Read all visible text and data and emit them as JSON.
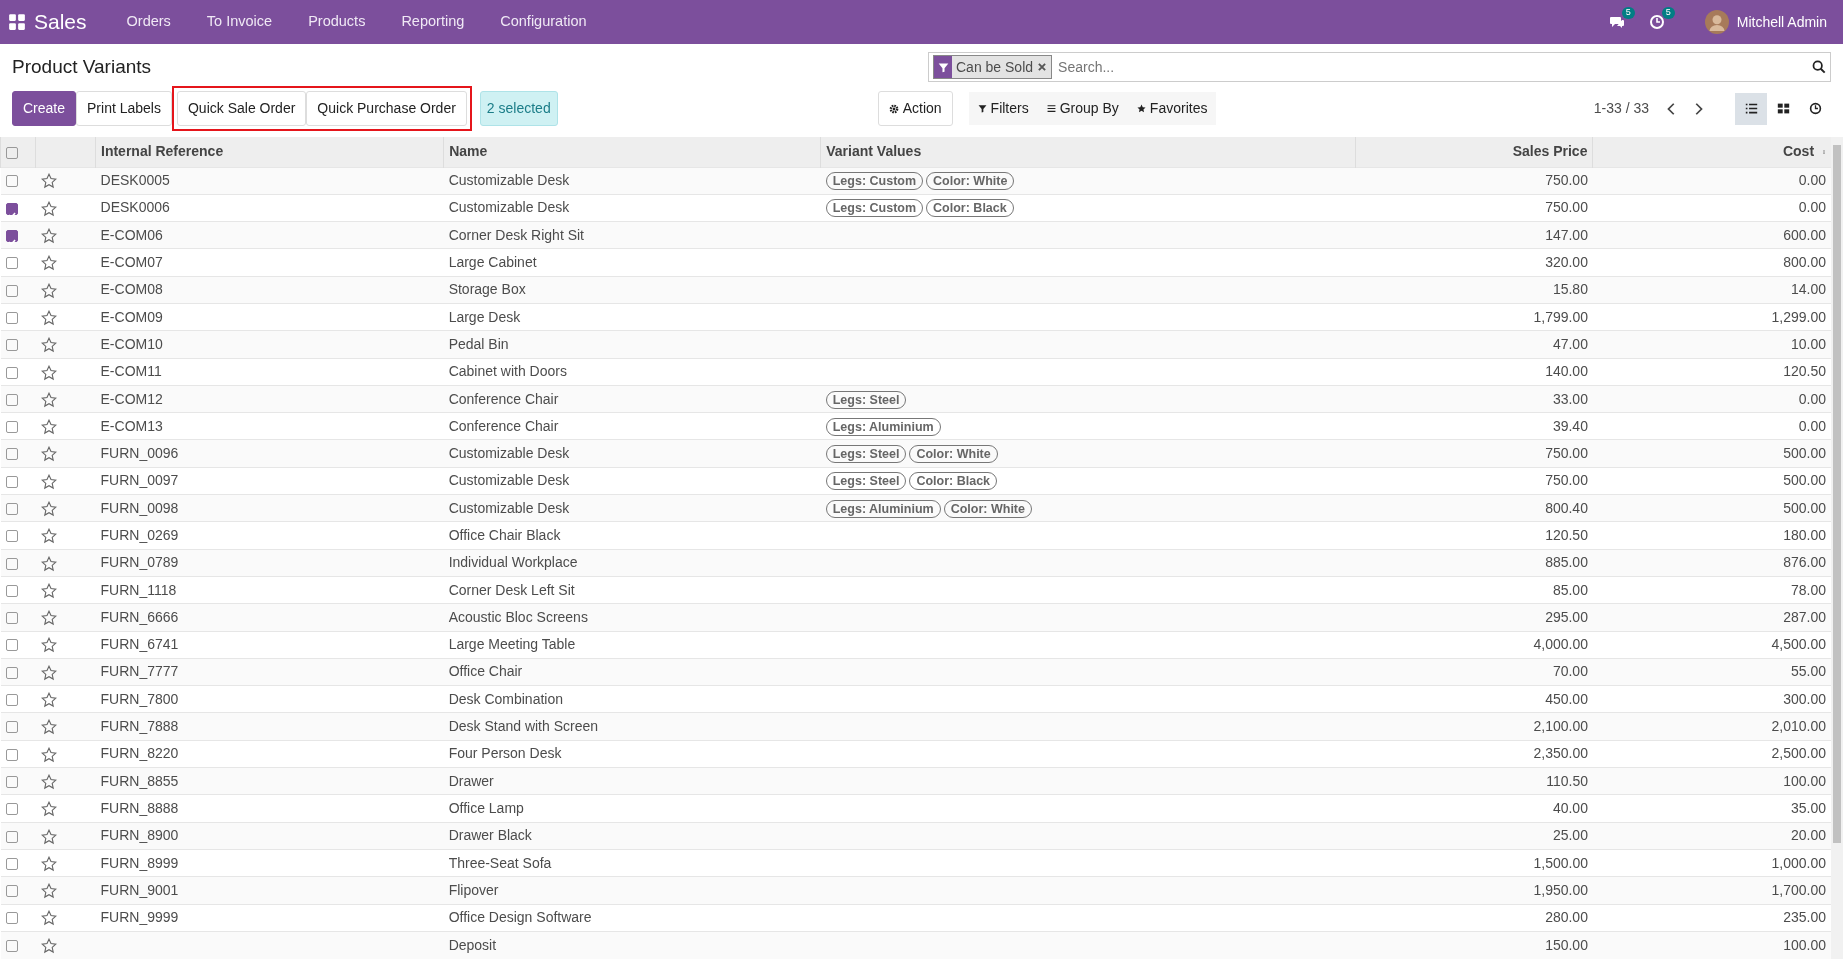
{
  "navbar": {
    "app": "Sales",
    "menu": [
      "Orders",
      "To Invoice",
      "Products",
      "Reporting",
      "Configuration"
    ],
    "messages_count": "5",
    "activities_count": "5",
    "user": "Mitchell Admin"
  },
  "page_title": "Product Variants",
  "buttons": [
    {
      "label": "Create",
      "kind": "primary",
      "highlighted": false
    },
    {
      "label": "Print Labels",
      "kind": "plain",
      "highlighted": false
    },
    {
      "label": "Quick Sale Order",
      "kind": "plain",
      "highlighted": true
    },
    {
      "label": "Quick Purchase Order",
      "kind": "plain",
      "highlighted": true
    }
  ],
  "selected_count": "2 selected",
  "action": "Action",
  "search": {
    "facet": "Can be Sold",
    "placeholder": "Search..."
  },
  "search_options": [
    "Filters",
    "Group By",
    "Favorites"
  ],
  "pager": "1-33 / 33",
  "views": [
    {
      "kind": "list",
      "selected": true
    },
    {
      "kind": "kanban",
      "selected": false
    },
    {
      "kind": "activity",
      "selected": false
    }
  ],
  "table": {
    "columns": [
      "Internal Reference",
      "Name",
      "Variant Values",
      "Sales Price",
      "Cost"
    ],
    "all_checked": false,
    "rows": [
      {
        "checked": false,
        "favorite": false,
        "ref": "DESK0005",
        "name": "Customizable Desk",
        "variants": [
          "Legs: Custom",
          "Color: White"
        ],
        "price": "750.00",
        "cost": "0.00"
      },
      {
        "checked": true,
        "favorite": false,
        "ref": "DESK0006",
        "name": "Customizable Desk",
        "variants": [
          "Legs: Custom",
          "Color: Black"
        ],
        "price": "750.00",
        "cost": "0.00"
      },
      {
        "checked": true,
        "favorite": false,
        "ref": "E-COM06",
        "name": "Corner Desk Right Sit",
        "variants": [],
        "price": "147.00",
        "cost": "600.00"
      },
      {
        "checked": false,
        "favorite": false,
        "ref": "E-COM07",
        "name": "Large Cabinet",
        "variants": [],
        "price": "320.00",
        "cost": "800.00"
      },
      {
        "checked": false,
        "favorite": false,
        "ref": "E-COM08",
        "name": "Storage Box",
        "variants": [],
        "price": "15.80",
        "cost": "14.00"
      },
      {
        "checked": false,
        "favorite": false,
        "ref": "E-COM09",
        "name": "Large Desk",
        "variants": [],
        "price": "1,799.00",
        "cost": "1,299.00"
      },
      {
        "checked": false,
        "favorite": false,
        "ref": "E-COM10",
        "name": "Pedal Bin",
        "variants": [],
        "price": "47.00",
        "cost": "10.00"
      },
      {
        "checked": false,
        "favorite": false,
        "ref": "E-COM11",
        "name": "Cabinet with Doors",
        "variants": [],
        "price": "140.00",
        "cost": "120.50"
      },
      {
        "checked": false,
        "favorite": false,
        "ref": "E-COM12",
        "name": "Conference Chair",
        "variants": [
          "Legs: Steel"
        ],
        "price": "33.00",
        "cost": "0.00"
      },
      {
        "checked": false,
        "favorite": false,
        "ref": "E-COM13",
        "name": "Conference Chair",
        "variants": [
          "Legs: Aluminium"
        ],
        "price": "39.40",
        "cost": "0.00"
      },
      {
        "checked": false,
        "favorite": false,
        "ref": "FURN_0096",
        "name": "Customizable Desk",
        "variants": [
          "Legs: Steel",
          "Color: White"
        ],
        "price": "750.00",
        "cost": "500.00"
      },
      {
        "checked": false,
        "favorite": false,
        "ref": "FURN_0097",
        "name": "Customizable Desk",
        "variants": [
          "Legs: Steel",
          "Color: Black"
        ],
        "price": "750.00",
        "cost": "500.00"
      },
      {
        "checked": false,
        "favorite": false,
        "ref": "FURN_0098",
        "name": "Customizable Desk",
        "variants": [
          "Legs: Aluminium",
          "Color: White"
        ],
        "price": "800.40",
        "cost": "500.00"
      },
      {
        "checked": false,
        "favorite": false,
        "ref": "FURN_0269",
        "name": "Office Chair Black",
        "variants": [],
        "price": "120.50",
        "cost": "180.00"
      },
      {
        "checked": false,
        "favorite": false,
        "ref": "FURN_0789",
        "name": "Individual Workplace",
        "variants": [],
        "price": "885.00",
        "cost": "876.00"
      },
      {
        "checked": false,
        "favorite": false,
        "ref": "FURN_1118",
        "name": "Corner Desk Left Sit",
        "variants": [],
        "price": "85.00",
        "cost": "78.00"
      },
      {
        "checked": false,
        "favorite": false,
        "ref": "FURN_6666",
        "name": "Acoustic Bloc Screens",
        "variants": [],
        "price": "295.00",
        "cost": "287.00"
      },
      {
        "checked": false,
        "favorite": false,
        "ref": "FURN_6741",
        "name": "Large Meeting Table",
        "variants": [],
        "price": "4,000.00",
        "cost": "4,500.00"
      },
      {
        "checked": false,
        "favorite": false,
        "ref": "FURN_7777",
        "name": "Office Chair",
        "variants": [],
        "price": "70.00",
        "cost": "55.00"
      },
      {
        "checked": false,
        "favorite": false,
        "ref": "FURN_7800",
        "name": "Desk Combination",
        "variants": [],
        "price": "450.00",
        "cost": "300.00"
      },
      {
        "checked": false,
        "favorite": false,
        "ref": "FURN_7888",
        "name": "Desk Stand with Screen",
        "variants": [],
        "price": "2,100.00",
        "cost": "2,010.00"
      },
      {
        "checked": false,
        "favorite": false,
        "ref": "FURN_8220",
        "name": "Four Person Desk",
        "variants": [],
        "price": "2,350.00",
        "cost": "2,500.00"
      },
      {
        "checked": false,
        "favorite": false,
        "ref": "FURN_8855",
        "name": "Drawer",
        "variants": [],
        "price": "110.50",
        "cost": "100.00"
      },
      {
        "checked": false,
        "favorite": false,
        "ref": "FURN_8888",
        "name": "Office Lamp",
        "variants": [],
        "price": "40.00",
        "cost": "35.00"
      },
      {
        "checked": false,
        "favorite": false,
        "ref": "FURN_8900",
        "name": "Drawer Black",
        "variants": [],
        "price": "25.00",
        "cost": "20.00"
      },
      {
        "checked": false,
        "favorite": false,
        "ref": "FURN_8999",
        "name": "Three-Seat Sofa",
        "variants": [],
        "price": "1,500.00",
        "cost": "1,000.00"
      },
      {
        "checked": false,
        "favorite": false,
        "ref": "FURN_9001",
        "name": "Flipover",
        "variants": [],
        "price": "1,950.00",
        "cost": "1,700.00"
      },
      {
        "checked": false,
        "favorite": false,
        "ref": "FURN_9999",
        "name": "Office Design Software",
        "variants": [],
        "price": "280.00",
        "cost": "235.00"
      },
      {
        "checked": false,
        "favorite": false,
        "ref": "",
        "name": "Deposit",
        "variants": [],
        "price": "150.00",
        "cost": "100.00"
      }
    ]
  }
}
